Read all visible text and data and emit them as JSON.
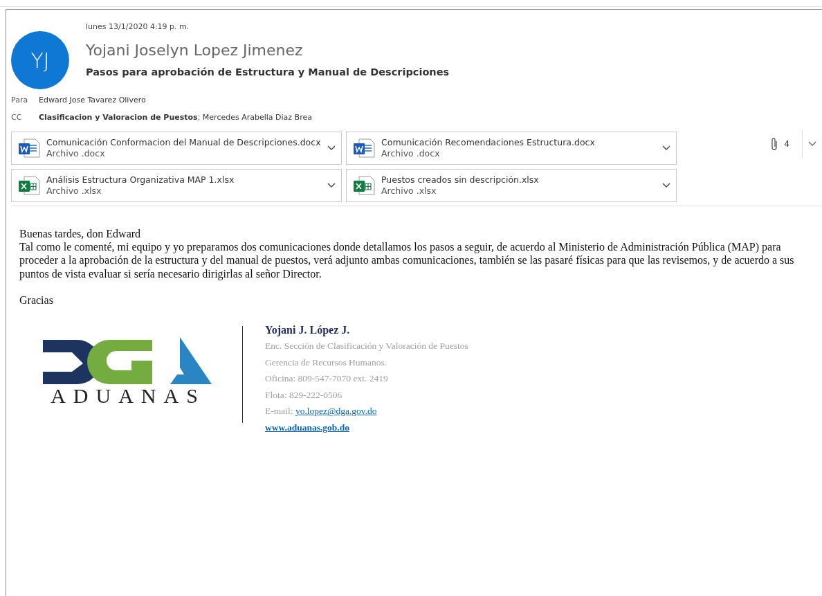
{
  "message": {
    "date": "lunes 13/1/2020 4:19 p. m.",
    "avatar_initials": "YJ",
    "sender": "Yojani Joselyn Lopez Jimenez",
    "subject": "Pasos para aprobación de Estructura y Manual de Descripciones",
    "recipients": [
      {
        "label": "Para",
        "value": "Edward Jose Tavarez Olivero"
      },
      {
        "label": "CC",
        "value": "**Clasificacion y Valoracion de Puestos**; Mercedes Arabella Diaz Brea"
      }
    ],
    "attachments": [
      {
        "name": "Comunicación Conformacion del Manual de Descripciones.docx",
        "type_label": "Archivo .docx",
        "kind": "word"
      },
      {
        "name": "Comunicación Recomendaciones Estructura.docx",
        "type_label": "Archivo .docx",
        "kind": "word"
      },
      {
        "name": "Análisis Estructura Organizativa MAP 1.xlsx",
        "type_label": "Archivo .xlsx",
        "kind": "excel"
      },
      {
        "name": "Puestos creados sin descripción.xlsx",
        "type_label": "Archivo .xlsx",
        "kind": "excel"
      }
    ],
    "attachment_count": "4"
  },
  "body": {
    "greeting": "Buenas tardes, don Edward",
    "text": "Tal como le comenté, mi equipo y yo preparamos dos comunicaciones donde detallamos los pasos a seguir, de acuerdo al Ministerio de Administración Pública (MAP) para proceder a la aprobación de la estructura y del manual de puestos, verá adjunto ambas comunicaciones, también se las pasaré físicas para que las revisemos, y de acuerdo a sus puntos de vista evaluar si sería necesario dirigirlas al señor Director.",
    "closing": "Gracias"
  },
  "signature": {
    "logo_text": "ADUANAS",
    "name": "Yojani J. López J.",
    "lines": [
      "Enc. Sección de Clasificación y Valoración de Puestos",
      "Gerencia de Recursos Humanos.",
      "Oficina: 809-547-7070 ext. 2419",
      "Flota: 829-222-0506"
    ],
    "email_label": "E-mail:",
    "email": "yo.lopez@dga.gov.do",
    "website": "www.aduanas.gob.do"
  }
}
